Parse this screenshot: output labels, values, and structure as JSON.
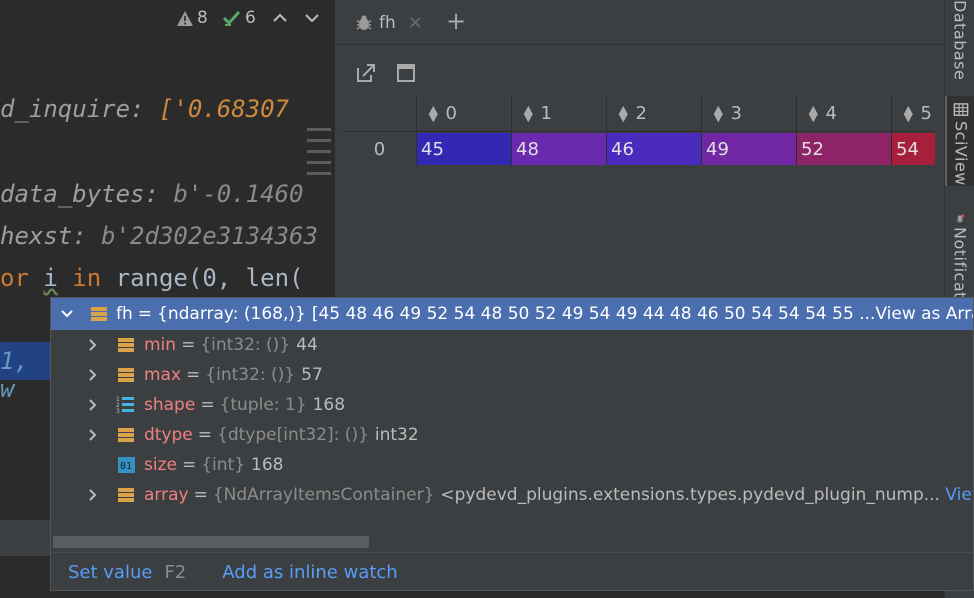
{
  "inspections": {
    "warnings": "8",
    "weak_warnings": "6"
  },
  "editor": {
    "line1_name": "d_inquire:",
    "line1_value": "['0.68307",
    "line2_name": "data_bytes:",
    "line2_value": "b'-0.1460",
    "line3_name": "hexst:",
    "line3_value": "b'2d302e3134363",
    "line4_for": "or",
    "line4_var": "i",
    "line4_in": "in",
    "line4_rest": "range(0, len(",
    "line5_text": "1, w"
  },
  "sciview": {
    "tab_label": "fh",
    "close_glyph": "×",
    "add_glyph": "+",
    "columns": [
      "0",
      "1",
      "2",
      "3",
      "4",
      "5"
    ],
    "row_index": "0",
    "values": [
      "45",
      "48",
      "46",
      "49",
      "52",
      "54"
    ],
    "cell_colors": [
      "#3228b4",
      "#6b29b0",
      "#4a2bbd",
      "#7127a4",
      "#8e2467",
      "#a81f3d"
    ]
  },
  "sidebar": {
    "database_label": "Database",
    "sciview_label": "SciView",
    "notifications_label": "Notifications"
  },
  "popup": {
    "main": {
      "name": "fh",
      "eq": "=",
      "type": "{ndarray: (168,)}",
      "value": "[45 48 46 49 52 54 48 50 52 49 54 49 44 48 46 50 54 54 54 55 ...",
      "link": "View as Array"
    },
    "children": [
      {
        "name": "min",
        "type": "{int32: ()}",
        "value": "44"
      },
      {
        "name": "max",
        "type": "{int32: ()}",
        "value": "57"
      },
      {
        "name": "shape",
        "type": "{tuple: 1}",
        "value": "168"
      },
      {
        "name": "dtype",
        "type": "{dtype[int32]: ()}",
        "value": "int32"
      },
      {
        "name": "size",
        "type": "{int}",
        "value": "168"
      },
      {
        "name": "array",
        "type": "{NdArrayItemsContainer}",
        "value": "<pydevd_plugins.extensions.types.pydevd_plugin_nump...",
        "link": "View"
      }
    ],
    "eq": "=",
    "footer": {
      "set_value": "Set value",
      "set_value_key": "F2",
      "add_watch": "Add as inline watch"
    }
  }
}
